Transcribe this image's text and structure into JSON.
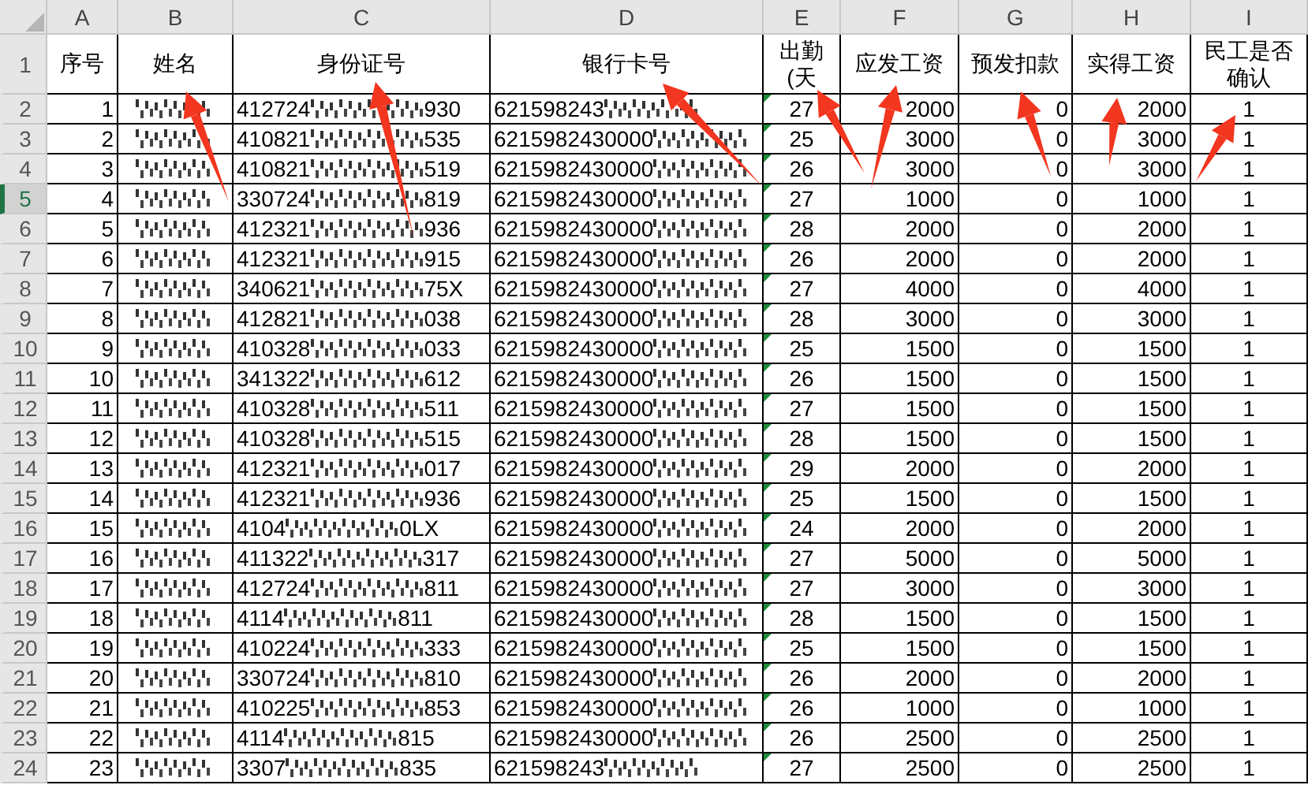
{
  "column_letters": [
    "A",
    "B",
    "C",
    "D",
    "E",
    "F",
    "G",
    "H",
    "I"
  ],
  "headers": [
    "序号",
    "姓名",
    "身份证号",
    "银行卡号",
    "出勤(天",
    "应发工资",
    "预发扣款",
    "实得工资",
    "民工是否确认"
  ],
  "header_row_number": "1",
  "rows": [
    {
      "row_number": "2",
      "selected": false,
      "no": "1",
      "id_start": "412724",
      "id_end": "930",
      "card_start": "621598243",
      "days": "27",
      "due": "2000",
      "deduct": "0",
      "paid": "2000",
      "confirmed": "1"
    },
    {
      "row_number": "3",
      "selected": false,
      "no": "2",
      "id_start": "410821",
      "id_end": "535",
      "card_start": "6215982430000",
      "days": "25",
      "due": "3000",
      "deduct": "0",
      "paid": "3000",
      "confirmed": "1"
    },
    {
      "row_number": "4",
      "selected": false,
      "no": "3",
      "id_start": "410821",
      "id_end": "519",
      "card_start": "6215982430000",
      "days": "26",
      "due": "3000",
      "deduct": "0",
      "paid": "3000",
      "confirmed": "1"
    },
    {
      "row_number": "5",
      "selected": true,
      "no": "4",
      "id_start": "330724",
      "id_end": "819",
      "card_start": "6215982430000",
      "days": "27",
      "due": "1000",
      "deduct": "0",
      "paid": "1000",
      "confirmed": "1"
    },
    {
      "row_number": "6",
      "selected": false,
      "no": "5",
      "id_start": "412321",
      "id_end": "936",
      "card_start": "6215982430000",
      "days": "28",
      "due": "2000",
      "deduct": "0",
      "paid": "2000",
      "confirmed": "1"
    },
    {
      "row_number": "7",
      "selected": false,
      "no": "6",
      "id_start": "412321",
      "id_end": "915",
      "card_start": "6215982430000",
      "days": "26",
      "due": "2000",
      "deduct": "0",
      "paid": "2000",
      "confirmed": "1"
    },
    {
      "row_number": "8",
      "selected": false,
      "no": "7",
      "id_start": "340621",
      "id_end": "75X",
      "card_start": "6215982430000",
      "days": "27",
      "due": "4000",
      "deduct": "0",
      "paid": "4000",
      "confirmed": "1"
    },
    {
      "row_number": "9",
      "selected": false,
      "no": "8",
      "id_start": "412821",
      "id_end": "038",
      "card_start": "6215982430000",
      "days": "28",
      "due": "3000",
      "deduct": "0",
      "paid": "3000",
      "confirmed": "1"
    },
    {
      "row_number": "10",
      "selected": false,
      "no": "9",
      "id_start": "410328",
      "id_end": "033",
      "card_start": "6215982430000",
      "days": "25",
      "due": "1500",
      "deduct": "0",
      "paid": "1500",
      "confirmed": "1"
    },
    {
      "row_number": "11",
      "selected": false,
      "no": "10",
      "id_start": "341322",
      "id_end": "612",
      "card_start": "6215982430000",
      "days": "26",
      "due": "1500",
      "deduct": "0",
      "paid": "1500",
      "confirmed": "1"
    },
    {
      "row_number": "12",
      "selected": false,
      "no": "11",
      "id_start": "410328",
      "id_end": "511",
      "card_start": "6215982430000",
      "days": "27",
      "due": "1500",
      "deduct": "0",
      "paid": "1500",
      "confirmed": "1"
    },
    {
      "row_number": "13",
      "selected": false,
      "no": "12",
      "id_start": "410328",
      "id_end": "515",
      "card_start": "6215982430000",
      "days": "28",
      "due": "1500",
      "deduct": "0",
      "paid": "1500",
      "confirmed": "1"
    },
    {
      "row_number": "14",
      "selected": false,
      "no": "13",
      "id_start": "412321",
      "id_end": "017",
      "card_start": "6215982430000",
      "days": "29",
      "due": "2000",
      "deduct": "0",
      "paid": "2000",
      "confirmed": "1"
    },
    {
      "row_number": "15",
      "selected": false,
      "no": "14",
      "id_start": "412321",
      "id_end": "936",
      "card_start": "6215982430000",
      "days": "25",
      "due": "1500",
      "deduct": "0",
      "paid": "1500",
      "confirmed": "1"
    },
    {
      "row_number": "16",
      "selected": false,
      "no": "15",
      "id_start": "4104",
      "id_end": "0LX",
      "card_start": "6215982430000",
      "days": "24",
      "due": "2000",
      "deduct": "0",
      "paid": "2000",
      "confirmed": "1"
    },
    {
      "row_number": "17",
      "selected": false,
      "no": "16",
      "id_start": "411322",
      "id_end": "317",
      "card_start": "6215982430000",
      "days": "27",
      "due": "5000",
      "deduct": "0",
      "paid": "5000",
      "confirmed": "1"
    },
    {
      "row_number": "18",
      "selected": false,
      "no": "17",
      "id_start": "412724",
      "id_end": "811",
      "card_start": "6215982430000",
      "days": "27",
      "due": "3000",
      "deduct": "0",
      "paid": "3000",
      "confirmed": "1"
    },
    {
      "row_number": "19",
      "selected": false,
      "no": "18",
      "id_start": "4114",
      "id_end": "811",
      "card_start": "6215982430000",
      "days": "28",
      "due": "1500",
      "deduct": "0",
      "paid": "1500",
      "confirmed": "1"
    },
    {
      "row_number": "20",
      "selected": false,
      "no": "19",
      "id_start": "410224",
      "id_end": "333",
      "card_start": "6215982430000",
      "days": "25",
      "due": "1500",
      "deduct": "0",
      "paid": "1500",
      "confirmed": "1"
    },
    {
      "row_number": "21",
      "selected": false,
      "no": "20",
      "id_start": "330724",
      "id_end": "810",
      "card_start": "6215982430000",
      "days": "26",
      "due": "2000",
      "deduct": "0",
      "paid": "2000",
      "confirmed": "1"
    },
    {
      "row_number": "22",
      "selected": false,
      "no": "21",
      "id_start": "410225",
      "id_end": "853",
      "card_start": "6215982430000",
      "days": "26",
      "due": "1000",
      "deduct": "0",
      "paid": "1000",
      "confirmed": "1"
    },
    {
      "row_number": "23",
      "selected": false,
      "no": "22",
      "id_start": "4114",
      "id_end": "815",
      "card_start": "6215982430000",
      "days": "26",
      "due": "2500",
      "deduct": "0",
      "paid": "2500",
      "confirmed": "1"
    },
    {
      "row_number": "24",
      "selected": false,
      "no": "23",
      "id_start": "3307",
      "id_end": "835",
      "card_start": "621598243",
      "days": "27",
      "due": "2500",
      "deduct": "0",
      "paid": "2500",
      "confirmed": "1"
    }
  ]
}
